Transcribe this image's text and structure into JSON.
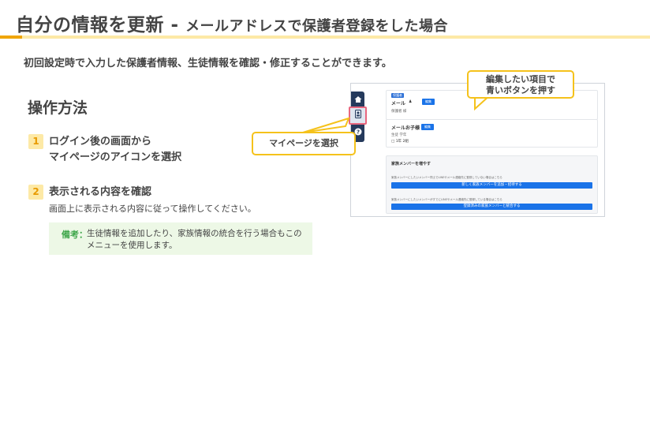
{
  "header": {
    "title_main": "自分の情報を更新",
    "title_sep": " - ",
    "title_sub": "メールアドレスで保護者登録をした場合"
  },
  "intro": "初回設定時で入力した保護者情報、生徒情報を確認・修正することができます。",
  "section_title": "操作方法",
  "steps": [
    {
      "num": "1",
      "line1": "ログイン後の画面から",
      "line2": "マイページのアイコンを選択"
    },
    {
      "num": "2",
      "line1": "表示される内容を確認",
      "desc": "画面上に表示される内容に従って操作してください。"
    }
  ],
  "note": {
    "label": "備考：",
    "line1": "生徒情報を追加したり、家族情報の統合を行う場合もこの",
    "line2": "メニューを使用します。"
  },
  "screenshot": {
    "sidebar_icons": [
      "home-icon",
      "mypage-icon",
      "help-icon"
    ],
    "card1": {
      "tag": "保護者",
      "label": "メール",
      "sub": "保護者 様",
      "edit": "編集"
    },
    "card2": {
      "label": "メールお子様",
      "sub": "生徒 学年",
      "grade": "1年 2組",
      "edit": "編集"
    },
    "family": {
      "title": "家族メンバーを増やす",
      "note1": "家族メンバーにしたいメンバー同士でLINEやメール連絡先に登録していない場合はこちら",
      "btn1": "新しく家族メンバーを追加・招待する",
      "note2": "家族メンバーにしたいメンバーがすでにLINEやメール連絡先に登録している場合はこちら",
      "btn2": "登録済みの家族メンバーと統合する"
    }
  },
  "callouts": {
    "select_mypage": "マイページを選択",
    "edit_line1": "編集したい項目で",
    "edit_line2": "青いボタンを押す"
  },
  "colors": {
    "accent_orange": "#f0a500",
    "accent_yellow": "#fde9a6",
    "callout_border": "#f5c21b",
    "note_green": "#3ea64a",
    "button_blue": "#1a73e8",
    "sidebar_navy": "#253a5c"
  }
}
